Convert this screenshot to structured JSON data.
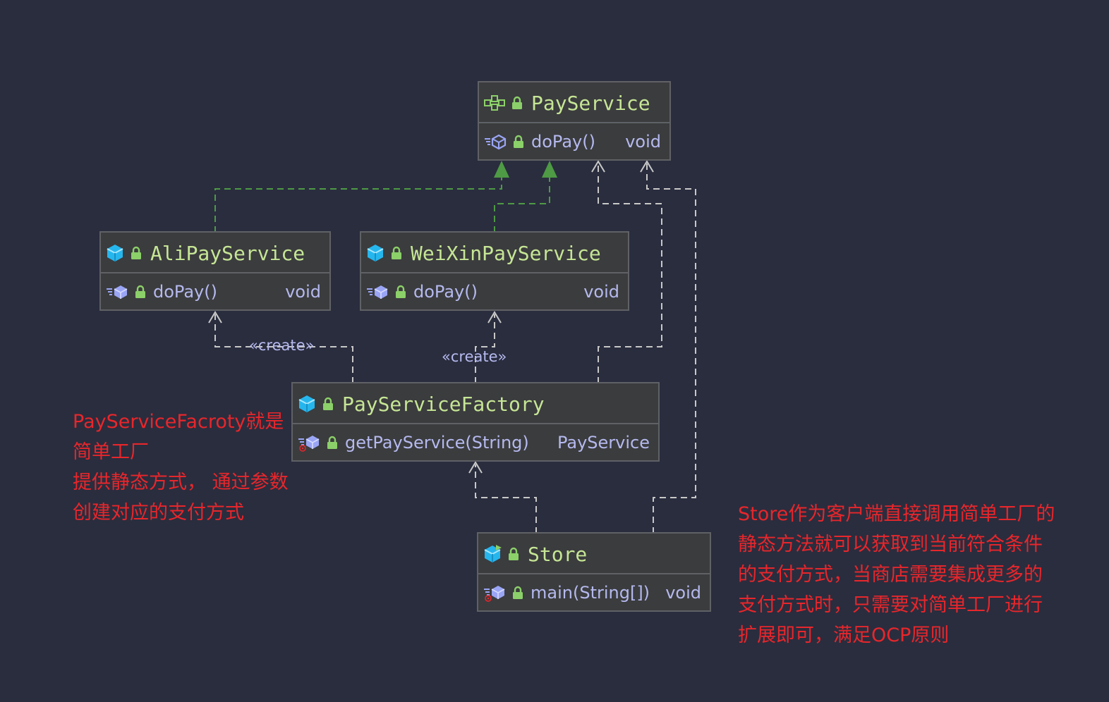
{
  "classes": {
    "pay_service": {
      "name": "PayService",
      "method": "doPay()",
      "return_type": "void",
      "icon": "interface-icon"
    },
    "ali_pay_service": {
      "name": "AliPayService",
      "method": "doPay()",
      "return_type": "void",
      "icon": "class-icon"
    },
    "weixin_pay_service": {
      "name": "WeiXinPayService",
      "method": "doPay()",
      "return_type": "void",
      "icon": "class-icon"
    },
    "pay_service_factory": {
      "name": "PayServiceFactory",
      "method": "getPayService(String)",
      "return_type": "PayService",
      "icon": "class-icon"
    },
    "store": {
      "name": "Store",
      "method": "main(String[])",
      "return_type": "void",
      "icon": "runnable-class-icon"
    }
  },
  "stereotypes": {
    "create_ali": "«create»",
    "create_weixin": "«create»"
  },
  "notes": {
    "factory_note": [
      "PayServiceFacroty就是",
      "简单工厂",
      "提供静态方式， 通过参数",
      "创建对应的支付方式"
    ],
    "store_note": [
      "Store作为客户端直接调用简单工厂的",
      "静态方法就可以获取到当前符合条件",
      "的支付方式，当商店需要集成更多的",
      "支付方式时，只需要对简单工厂进行",
      "扩展即可，满足OCP原则"
    ]
  },
  "colors": {
    "background": "#2a2d3e",
    "box_fill": "#3b3c3e",
    "box_border": "#5f6165",
    "class_name": "#c6e695",
    "method_text": "#b5b9ee",
    "implements_line": "#4e9a45",
    "dependency_line": "#c8c8c8",
    "note_text": "#e8262b",
    "class_icon": "#26b6ee",
    "lock_icon": "#8bd069"
  }
}
